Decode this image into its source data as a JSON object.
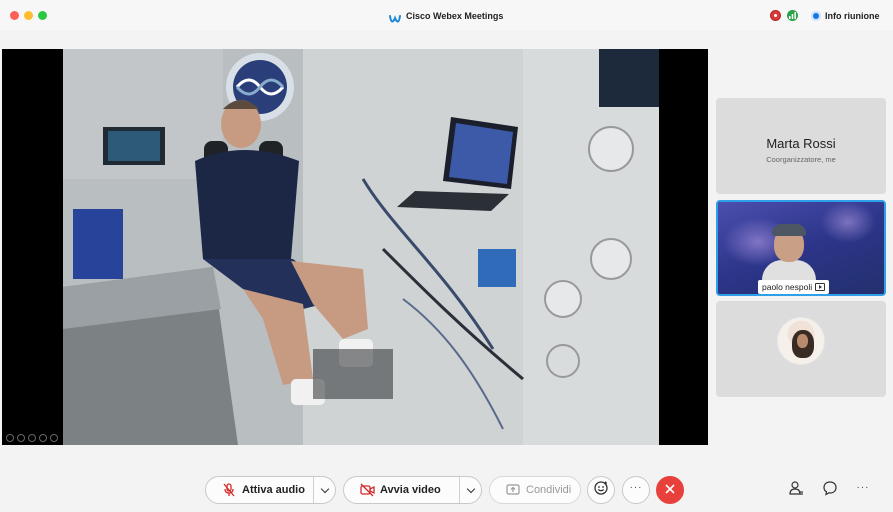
{
  "window": {
    "title": "Cisco Webex Meetings",
    "info_label": "Info riunione"
  },
  "stage": {
    "content": "shared image: astronaut exercising inside space station module"
  },
  "participants": [
    {
      "name": "Marta Rossi",
      "role": "Coorganizzatore, me",
      "video": false
    },
    {
      "name": "paolo nespoli",
      "video": true,
      "active_speaker": true,
      "sharing": true
    },
    {
      "name": "",
      "video": false,
      "avatar": true
    }
  ],
  "toolbar": {
    "audio_label": "Attiva audio",
    "video_label": "Avvia video",
    "share_label": "Condividi",
    "more_label": "···",
    "right_more_label": "···"
  },
  "colors": {
    "accent": "#2f9fea",
    "end_call": "#e8403b",
    "record": "#d83b3b",
    "signal": "#2aa24a",
    "info": "#1a73e8"
  },
  "icons": {
    "close": "traffic-close",
    "minimize": "traffic-minimize",
    "maximize": "traffic-maximize",
    "app": "webex-logo-icon",
    "record": "record-icon",
    "signal": "network-signal-icon",
    "info": "info-icon",
    "audio": "mic-muted-icon",
    "video": "camera-off-icon",
    "share": "share-screen-icon",
    "reactions": "reactions-icon",
    "end": "close-icon",
    "participants": "participants-icon",
    "chat": "chat-icon"
  }
}
